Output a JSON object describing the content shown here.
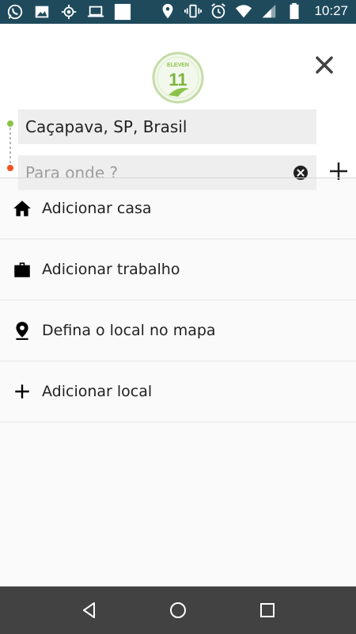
{
  "status_bar": {
    "time": "10:27",
    "left_icons": [
      "whatsapp-icon",
      "image-icon",
      "gps-icon",
      "laptop-icon",
      "square-icon"
    ],
    "right_icons": [
      "location-icon",
      "vibrate-icon",
      "alarm-icon",
      "wifi-icon",
      "signal-icon",
      "battery-icon"
    ]
  },
  "header": {
    "logo_text": "ELEVEN",
    "logo_number": "11",
    "close_icon": "close-icon"
  },
  "route": {
    "origin": "Caçapava, SP, Brasil",
    "destination_value": "",
    "destination_placeholder": "Para onde ?",
    "origin_dot_color": "#8bc34a",
    "destination_dot_color": "#f4511e"
  },
  "list": {
    "items": [
      {
        "label": "Adicionar casa",
        "icon": "home-icon"
      },
      {
        "label": "Adicionar trabalho",
        "icon": "briefcase-icon"
      },
      {
        "label": "Defina o local no mapa",
        "icon": "map-pin-icon"
      },
      {
        "label": "Adicionar local",
        "icon": "plus-icon"
      }
    ]
  },
  "nav_bar": {
    "buttons": [
      "back-icon",
      "home-circle-icon",
      "recents-icon"
    ]
  },
  "colors": {
    "status_bar": "#1e4a5c",
    "field_background": "#eeeeee",
    "nav_bar": "#424242",
    "logo_green": "#8bc34a"
  }
}
